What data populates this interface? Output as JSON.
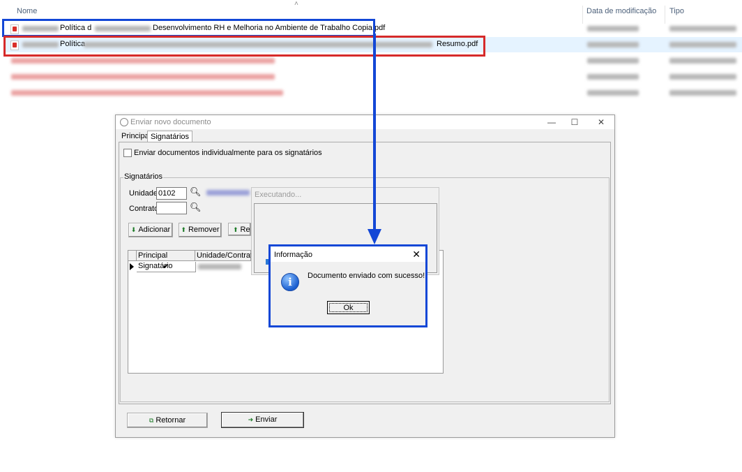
{
  "explorer": {
    "columns": {
      "name": "Nome",
      "modified": "Data de modificação",
      "type": "Tipo"
    },
    "files": [
      {
        "visible_name_part1": "Política d",
        "visible_name_part2": "Desenvolvimento RH e Melhoria no Ambiente de Trabalho Copia.pdf"
      },
      {
        "visible_name_part1": "Política",
        "visible_name_part2": "Resumo.pdf"
      }
    ]
  },
  "window": {
    "title": "Enviar novo documento",
    "controls": {
      "minimize": "—",
      "maximize": "☐",
      "close": "✕"
    },
    "tabs": [
      "Principal",
      "Signatários"
    ],
    "individual_checkbox_label": "Enviar documentos individualmente para os signatários",
    "group_title": "Signatários",
    "unidade_label": "Unidade:",
    "unidade_value": "0102",
    "contrato_label": "Contrato:",
    "contrato_value": "",
    "buttons": {
      "add": "Adicionar",
      "remove": "Remover",
      "third": "Re"
    },
    "grid": {
      "headers": [
        "Principal Signatário",
        "Unidade/Contrato"
      ],
      "row_checked": "✔"
    },
    "footer": {
      "back": "Retornar",
      "send": "Enviar"
    }
  },
  "executing": {
    "title": "Executando..."
  },
  "info_dialog": {
    "title": "Informação",
    "message": "Documento enviado com sucesso!",
    "ok": "Ok",
    "close": "✕"
  },
  "colors": {
    "highlight_blue": "#1347d6",
    "highlight_red": "#d62a2a",
    "selection": "#e5f3ff"
  }
}
